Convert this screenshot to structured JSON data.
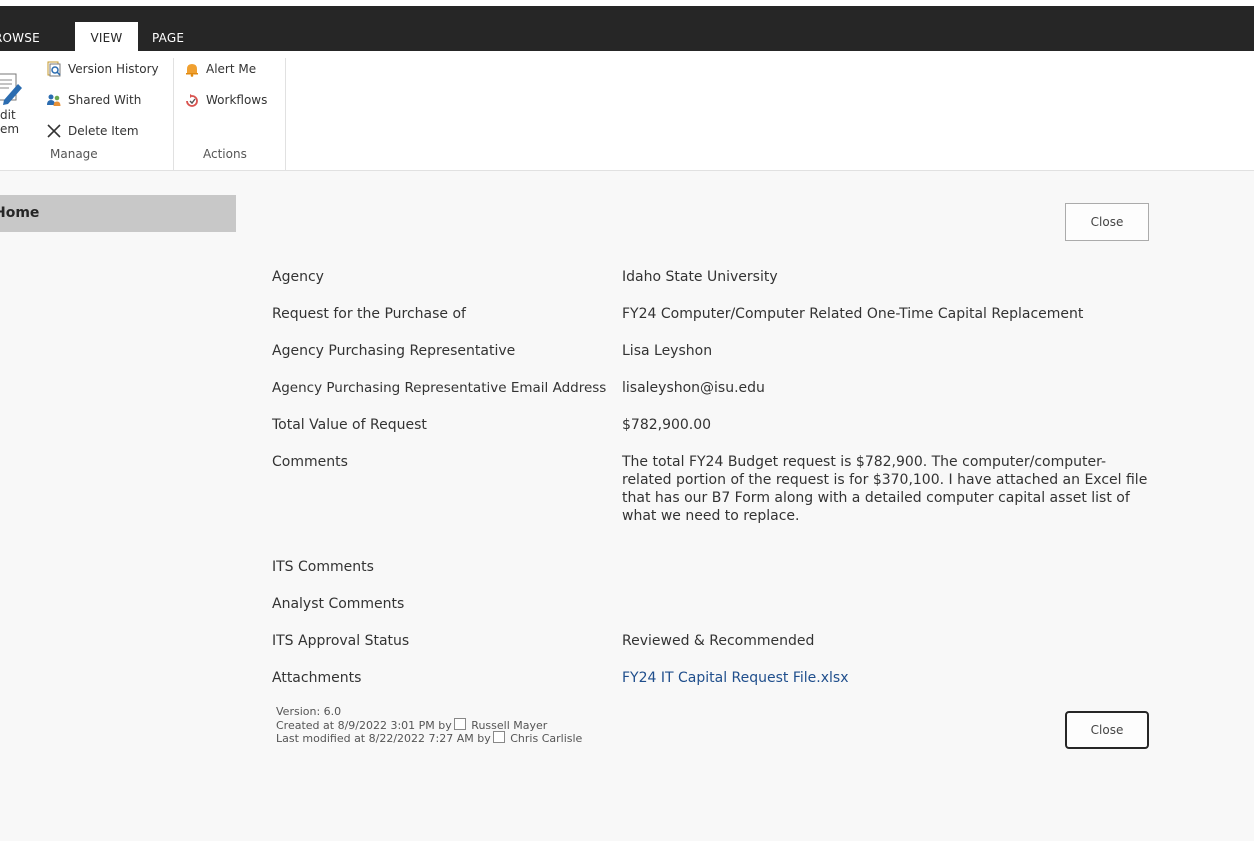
{
  "ribbon_tabs": [
    {
      "label": "ROWSE"
    },
    {
      "label": "VIEW"
    },
    {
      "label": "PAGE"
    }
  ],
  "ribbon": {
    "edit_item_partial": {
      "line1": "dit",
      "line2": "em"
    },
    "manage": {
      "label": "Manage",
      "buttons": [
        {
          "label": "Version History",
          "icon": "version-history-icon"
        },
        {
          "label": "Shared With",
          "icon": "shared-with-icon"
        },
        {
          "label": "Delete Item",
          "icon": "delete-x-icon"
        }
      ]
    },
    "actions": {
      "label": "Actions",
      "buttons": [
        {
          "label": "Alert Me",
          "icon": "bell-icon"
        },
        {
          "label": "Workflows",
          "icon": "workflow-icon"
        }
      ]
    }
  },
  "nav": {
    "home": "Home"
  },
  "close_label": "Close",
  "fields": [
    {
      "label": "Agency",
      "value": "Idaho State University"
    },
    {
      "label": "Request for the Purchase of",
      "value": "FY24 Computer/Computer Related One-Time Capital Replacement"
    },
    {
      "label": "Agency Purchasing Representative",
      "value": "Lisa Leyshon"
    },
    {
      "label": "Agency Purchasing Representative Email Address",
      "value": "lisaleyshon@isu.edu"
    },
    {
      "label": "Total Value of Request",
      "value": "$782,900.00"
    },
    {
      "label": "Comments",
      "value": "The total FY24 Budget request is $782,900. The computer/computer-related portion of the request is for $370,100. I have attached an Excel file that has our B7 Form along with a detailed computer capital asset list of what we need to replace."
    },
    {
      "label": "ITS Comments",
      "value": ""
    },
    {
      "label": "Analyst Comments",
      "value": ""
    },
    {
      "label": "ITS Approval Status",
      "value": "Reviewed & Recommended"
    },
    {
      "label": "Attachments",
      "value": "FY24 IT Capital Request File.xlsx"
    }
  ],
  "meta": {
    "version": "Version: 6.0",
    "created_prefix": "Created at 8/9/2022 3:01 PM by",
    "created_by": "Russell Mayer",
    "modified_prefix": "Last modified at 8/22/2022 7:27 AM by",
    "modified_by": "Chris Carlisle"
  },
  "colors": {
    "tabbar": "#262626",
    "link": "#1f4e8c",
    "nav_selected": "#c8c8c8"
  }
}
